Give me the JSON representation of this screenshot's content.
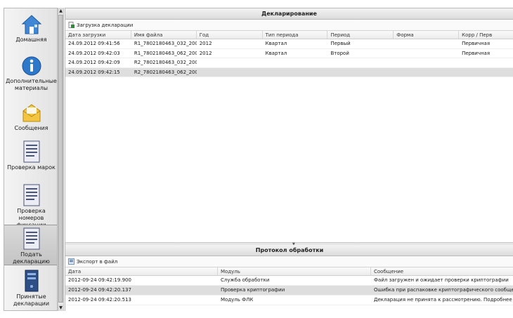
{
  "sidebar": {
    "items": [
      {
        "label": "Домашняя",
        "icon": "house-icon"
      },
      {
        "label": "Дополнительные материалы",
        "icon": "info-icon"
      },
      {
        "label": "Сообщения",
        "icon": "envelope-icon"
      },
      {
        "label": "Проверка марок",
        "icon": "document-icon"
      },
      {
        "label": "Проверка номеров фиксации",
        "icon": "document-icon"
      },
      {
        "label": "Подать декларацию",
        "icon": "document-icon",
        "active": true
      },
      {
        "label": "Принятые декларации",
        "icon": "server-icon"
      }
    ],
    "scroll_up": "▲",
    "scroll_down": "▼"
  },
  "declarations": {
    "title": "Декларирование",
    "toolbar": {
      "load_label": "Загрузка декларации",
      "icon": "upload-document-icon"
    },
    "columns": [
      "Дата загрузки",
      "Имя файла",
      "Год",
      "Тип периода",
      "Период",
      "Форма",
      "Корр / Перв"
    ],
    "rows": [
      [
        "24.09.2012 09:41:56",
        "R1_7802180463_032_200...",
        "2012",
        "Квартал",
        "Первый",
        "",
        "Первичная"
      ],
      [
        "24.09.2012 09:42:03",
        "R1_7802180463_062_200...",
        "2012",
        "Квартал",
        "Второй",
        "",
        "Первичная"
      ],
      [
        "24.09.2012 09:42:09",
        "R2_7802180463_032_200...",
        "",
        "",
        "",
        "",
        ""
      ],
      [
        "24.09.2012 09:42:15",
        "R2_7802180463_062_200...",
        "",
        "",
        "",
        "",
        ""
      ]
    ],
    "selected_row": 3
  },
  "splitter_grip": "▼",
  "protocol": {
    "title": "Протокол обработки",
    "toolbar": {
      "export_label": "Экспорт в файл",
      "icon": "export-icon"
    },
    "columns": [
      "Дата",
      "Модуль",
      "Сообщение"
    ],
    "rows": [
      [
        "2012-09-24 09:42:19.900",
        "Служба обработки",
        "Файл загружен и ожидает проверки криптографии"
      ],
      [
        "2012-09-24 09:42:20.137",
        "Проверка криптографии",
        "Ошибка при распаковке криптографического сообщения. Ошиб"
      ],
      [
        "2012-09-24 09:42:20.513",
        "Модуль ФЛК",
        "Декларация не принята к рассмотрению. Подробнее об ошибке"
      ]
    ],
    "selected_row": 1
  }
}
